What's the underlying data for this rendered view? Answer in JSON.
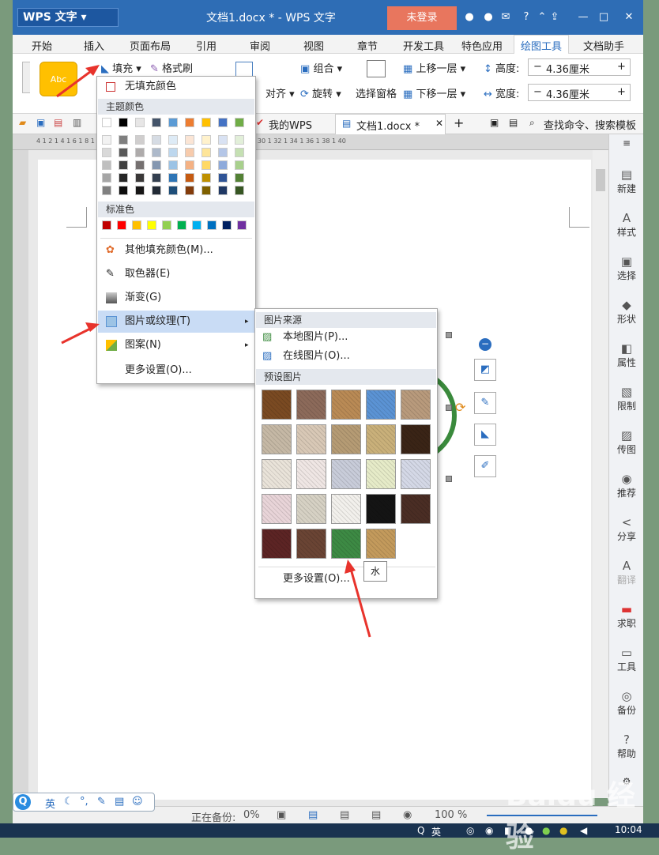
{
  "app": {
    "logo": "WPS 文字",
    "title": "文档1.docx * - WPS 文字",
    "login": "未登录"
  },
  "tabs": [
    "开始",
    "插入",
    "页面布局",
    "引用",
    "审阅",
    "视图",
    "章节",
    "开发工具",
    "特色应用",
    "绘图工具",
    "文档助手"
  ],
  "ribbon": {
    "style_sample": "Abc",
    "fill": "填充",
    "format_painter": "格式刷",
    "align": "对齐",
    "group": "组合",
    "rotate": "旋转",
    "selection_pane": "选择窗格",
    "bring_forward": "上移一层",
    "send_backward": "下移一层",
    "height_label": "高度:",
    "height_value": "4.36厘米",
    "width_label": "宽度:",
    "width_value": "4.36厘米"
  },
  "qbar": {
    "tab1": "我的WPS",
    "tab2": "文档1.docx *",
    "search": "查找命令、搜索模板"
  },
  "ruler_text": "4  1  2  1  4  1  6  1  8  1  10  1  12  1  14  1  16  1  18  1  20  1  22  1  24  1  26  1  28  1  30  1  32  1  34  1  36  1  38  1  40",
  "fill_menu": {
    "no_fill": "无填充颜色",
    "theme_colors": "主题颜色",
    "standard_colors": "标准色",
    "more_colors": "其他填充颜色(M)...",
    "eyedropper": "取色器(E)",
    "gradient": "渐变(G)",
    "picture_texture": "图片或纹理(T)",
    "pattern": "图案(N)",
    "more_settings": "更多设置(O)..."
  },
  "theme_top": [
    "#ffffff",
    "#000000",
    "#e7e6e6",
    "#44546a",
    "#5b9bd5",
    "#ed7d31",
    "#ffc000",
    "#4472c4",
    "#70ad47"
  ],
  "theme_columns": [
    [
      "#f2f2f2",
      "#d9d9d9",
      "#bfbfbf",
      "#a6a6a6",
      "#808080"
    ],
    [
      "#7f7f7f",
      "#595959",
      "#3f3f3f",
      "#262626",
      "#0d0d0d"
    ],
    [
      "#d0cece",
      "#aeabab",
      "#757070",
      "#3a3838",
      "#171616"
    ],
    [
      "#d6dce4",
      "#adb9ca",
      "#8497b0",
      "#333f4f",
      "#222a35"
    ],
    [
      "#deebf6",
      "#bdd7ee",
      "#9cc3e5",
      "#2e75b5",
      "#1e4e79"
    ],
    [
      "#fbe5d5",
      "#f7cbac",
      "#f4b183",
      "#c55a11",
      "#833c0b"
    ],
    [
      "#fff2cc",
      "#fee599",
      "#ffd965",
      "#bf9000",
      "#7f6000"
    ],
    [
      "#d9e2f3",
      "#b4c6e7",
      "#8eaadb",
      "#2f5496",
      "#1f3864"
    ],
    [
      "#e2efd9",
      "#c5e0b3",
      "#a8d08d",
      "#538135",
      "#375623"
    ]
  ],
  "standard_colors": [
    "#c00000",
    "#ff0000",
    "#ffc000",
    "#ffff00",
    "#92d050",
    "#00b050",
    "#00b0f0",
    "#0070c0",
    "#002060",
    "#7030a0"
  ],
  "texture_menu": {
    "source": "图片来源",
    "local": "本地图片(P)...",
    "online": "在线图片(O)...",
    "preset": "预设图片",
    "more_settings": "更多设置(O)...",
    "tooltip": "水"
  },
  "textures": [
    [
      "#7a4a22",
      "#8c6a5a",
      "#b98a55",
      "#5b93d4",
      "#b89a7c"
    ],
    [
      "#c5b8a5",
      "#d8c8b6",
      "#b59b74",
      "#c9b07a",
      "#3a2416"
    ],
    [
      "#e9e3d9",
      "#efe6e4",
      "#c8ccd9",
      "#e6ebc8",
      "#d4d8e6"
    ],
    [
      "#e8d4d8",
      "#d6d1c4",
      "#f2f0ec",
      "#141414",
      "#4a2d24"
    ],
    [
      "#5c2424",
      "#6a4434",
      "#3d8a44",
      "#c39a5c",
      ""
    ]
  ],
  "sidepanel": [
    {
      "icon": "▤",
      "label": "新建"
    },
    {
      "icon": "A",
      "label": "样式"
    },
    {
      "icon": "▣",
      "label": "选择"
    },
    {
      "icon": "◆",
      "label": "形状"
    },
    {
      "icon": "◧",
      "label": "属性"
    },
    {
      "icon": "▧",
      "label": "限制"
    },
    {
      "icon": "▨",
      "label": "传图"
    },
    {
      "icon": "◉",
      "label": "推荐"
    },
    {
      "icon": "<",
      "label": "分享"
    },
    {
      "icon": "A",
      "label": "翻译"
    },
    {
      "icon": "▬",
      "label": "求职"
    },
    {
      "icon": "▭",
      "label": "工具"
    },
    {
      "icon": "◎",
      "label": "备份"
    },
    {
      "icon": "?",
      "label": "帮助"
    }
  ],
  "status": {
    "backup": "正在备份:",
    "backup_pct": "0%",
    "zoom": "100 %"
  },
  "taskbar": {
    "ime": "英",
    "time": "10:04"
  },
  "watermark": "Baidu 经验"
}
